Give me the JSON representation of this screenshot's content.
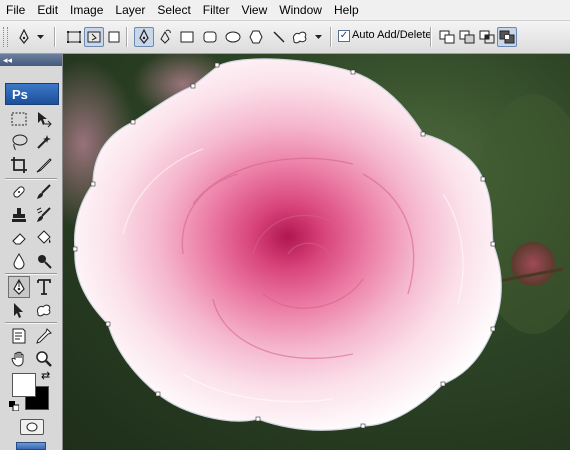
{
  "menu": [
    "File",
    "Edit",
    "Image",
    "Layer",
    "Select",
    "Filter",
    "View",
    "Window",
    "Help"
  ],
  "options": {
    "auto_add_delete_label": "Auto Add/Delete",
    "auto_add_delete_checked": true
  },
  "tools_panel": {
    "logo": "Ps",
    "active_tool": "pen-tool"
  },
  "colors": {
    "foreground": "#ffffff",
    "background": "#000000",
    "path_stroke": "#cfd6df"
  }
}
